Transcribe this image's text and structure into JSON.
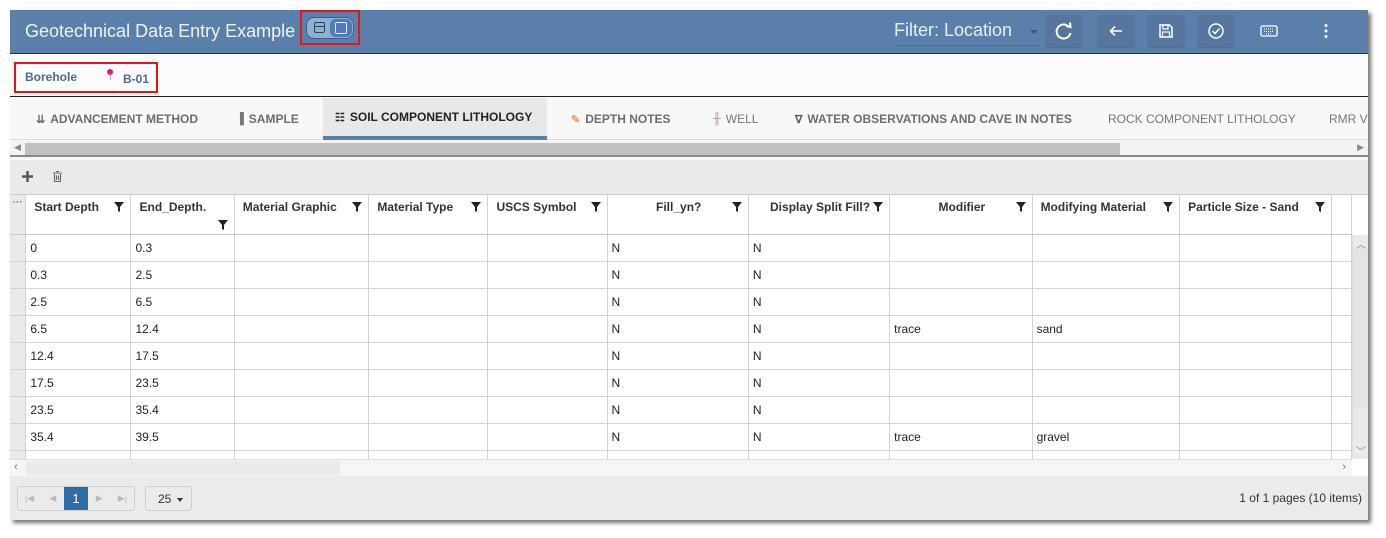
{
  "app": {
    "title": "Geotechnical Data Entry Example",
    "filter_label": "Filter: Location",
    "toolbar_icons": [
      "refresh-icon",
      "back-arrow-icon",
      "save-icon",
      "check-circle-icon",
      "keyboard-icon",
      "more-vert-icon"
    ]
  },
  "borehole": {
    "label": "Borehole",
    "value": "B-01"
  },
  "tabs": [
    {
      "label": "ADVANCEMENT METHOD",
      "icon": "⇊"
    },
    {
      "label": "SAMPLE",
      "icon": "▐"
    },
    {
      "label": "SOIL COMPONENT LITHOLOGY",
      "icon": "☷",
      "active": true
    },
    {
      "label": "DEPTH NOTES",
      "icon": "✎"
    },
    {
      "label": "WELL",
      "icon": "╫"
    },
    {
      "label": "WATER OBSERVATIONS AND CAVE IN NOTES",
      "icon": "∇"
    },
    {
      "label": "ROCK COMPONENT LITHOLOGY",
      "icon": ""
    },
    {
      "label": "RMR V",
      "icon": ""
    }
  ],
  "grid": {
    "row_header_label": "···",
    "columns": [
      "Start Depth",
      "End_Depth.",
      "Material Graphic",
      "Material Type",
      "USCS Symbol",
      "Fill_yn?",
      "Display Split Fill?",
      "Modifier",
      "Modifying Material",
      "Particle Size - Sand"
    ],
    "rows": [
      [
        "0",
        "0.3",
        "",
        "",
        "",
        "N",
        "N",
        "",
        "",
        ""
      ],
      [
        "0.3",
        "2.5",
        "",
        "",
        "",
        "N",
        "N",
        "",
        "",
        ""
      ],
      [
        "2.5",
        "6.5",
        "",
        "",
        "",
        "N",
        "N",
        "",
        "",
        ""
      ],
      [
        "6.5",
        "12.4",
        "",
        "",
        "",
        "N",
        "N",
        "trace",
        "sand",
        ""
      ],
      [
        "12.4",
        "17.5",
        "",
        "",
        "",
        "N",
        "N",
        "",
        "",
        ""
      ],
      [
        "17.5",
        "23.5",
        "",
        "",
        "",
        "N",
        "N",
        "",
        "",
        ""
      ],
      [
        "23.5",
        "35.4",
        "",
        "",
        "",
        "N",
        "N",
        "",
        "",
        ""
      ],
      [
        "35.4",
        "39.5",
        "",
        "",
        "",
        "N",
        "N",
        "trace",
        "gravel",
        ""
      ]
    ]
  },
  "pager": {
    "current_page": "1",
    "page_size": "25",
    "info": "1 of 1 pages (10 items)"
  },
  "colors": {
    "header_bg": "#5b7fab",
    "active_tab_underline": "#5b7fab",
    "current_page_bg": "#2f6ca6",
    "highlight_box": "#ee1111",
    "pin": "#e8177d"
  }
}
